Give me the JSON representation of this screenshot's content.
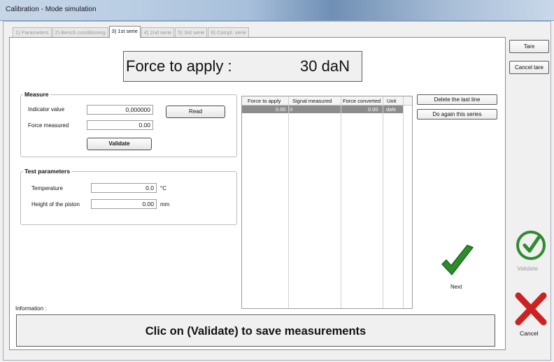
{
  "window": {
    "title": "Calibration - Mode simulation"
  },
  "tabs": [
    {
      "label": "1) Parameters",
      "active": false
    },
    {
      "label": "2) Bench conditioning",
      "active": false
    },
    {
      "label": "3) 1st serie",
      "active": true
    },
    {
      "label": "4) 2nd serie",
      "active": false
    },
    {
      "label": "5) 3rd serie",
      "active": false
    },
    {
      "label": "6) Compl. serie",
      "active": false
    }
  ],
  "force_to_apply": {
    "label": "Force to apply :",
    "value": "30 daN"
  },
  "measure": {
    "legend": "Measure",
    "indicator_label": "Indicator value",
    "indicator_value": "0,000000",
    "force_label": "Force measured",
    "force_value": "0.00",
    "read_button": "Read",
    "validate_button": "Validate"
  },
  "test_parameters": {
    "legend": "Test parameters",
    "temperature_label": "Temperature",
    "temperature_value": "0.0",
    "temperature_unit": "°C",
    "height_label": "Height of the piston",
    "height_value": "0.00",
    "height_unit": "mm"
  },
  "table": {
    "columns": [
      "Force to apply",
      "Signal measured",
      "Force converted",
      "Unit"
    ],
    "rows": [
      {
        "force_to_apply": "0.00",
        "signal_measured": "0",
        "force_converted": "0.00",
        "unit": "daN"
      }
    ]
  },
  "actions": {
    "delete_last_line": "Delete the last line",
    "do_again_series": "Do again this series",
    "next": "Next",
    "tare": "Tare",
    "cancel_tare": "Cancel tare",
    "validate": "Validate",
    "cancel": "Cancel"
  },
  "information": {
    "label": "Information :",
    "message": "Clic on (Validate) to save measurements"
  },
  "colors": {
    "check_green": "#2e8b2e",
    "cancel_red": "#cc2222",
    "selected_row": "#8c8c8c"
  },
  "icons": {
    "next": "checkmark-icon",
    "validate": "circle-check-icon",
    "cancel": "red-x-icon"
  }
}
